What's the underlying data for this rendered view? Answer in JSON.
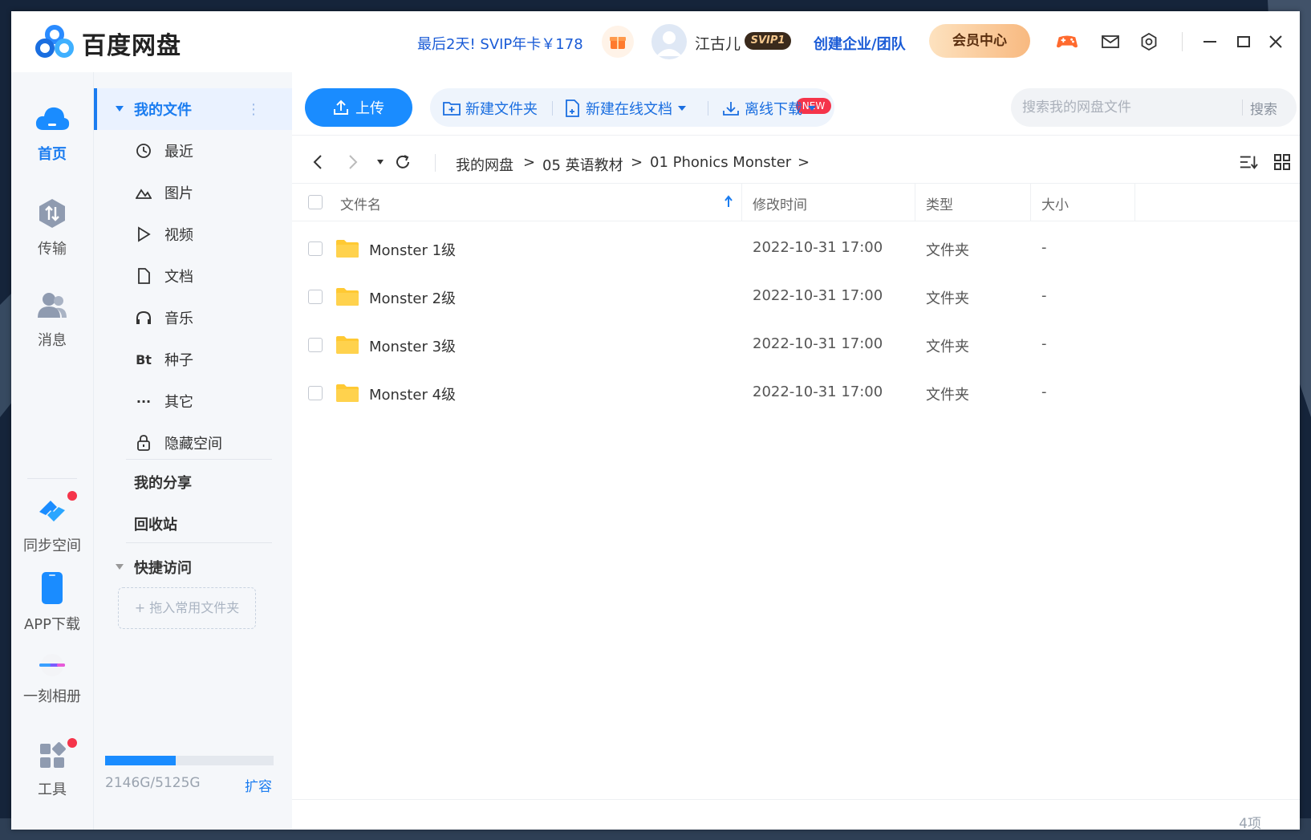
{
  "app": {
    "title": "百度网盘",
    "promo": "最后2天! SVIP年卡￥178",
    "username": "江古儿",
    "svip_badge": "SVIP1",
    "enterprise": "创建企业/团队",
    "member_center": "会员中心"
  },
  "leftnav": [
    {
      "label": "首页",
      "icon": "cloud-icon",
      "active": true
    },
    {
      "label": "传输",
      "icon": "transfer-icon",
      "active": false
    },
    {
      "label": "消息",
      "icon": "message-icon",
      "active": false
    },
    {
      "label": "同步空间",
      "icon": "sync-icon",
      "active": false
    },
    {
      "label": "APP下载",
      "icon": "phone-icon",
      "active": false
    },
    {
      "label": "一刻相册",
      "icon": "album-icon",
      "active": false
    },
    {
      "label": "工具",
      "icon": "tools-icon",
      "active": false
    }
  ],
  "sidebar": {
    "my_files": "我的文件",
    "items": [
      {
        "label": "最近",
        "icon": "clock-icon"
      },
      {
        "label": "图片",
        "icon": "image-icon"
      },
      {
        "label": "视频",
        "icon": "video-icon"
      },
      {
        "label": "文档",
        "icon": "document-icon"
      },
      {
        "label": "音乐",
        "icon": "headphones-icon"
      },
      {
        "label": "种子",
        "icon": "bt-icon"
      },
      {
        "label": "其它",
        "icon": "more-icon"
      },
      {
        "label": "隐藏空间",
        "icon": "lock-icon"
      }
    ],
    "bt_glyph": "Bt",
    "my_share": "我的分享",
    "recycle": "回收站",
    "quick_access": "快捷访问",
    "drop_hint": "+ 拖入常用文件夹",
    "storage_text": "2146G/5125G",
    "storage_used_fraction": 0.419,
    "expand": "扩容"
  },
  "toolbar": {
    "upload": "上传",
    "new_folder": "新建文件夹",
    "new_doc": "新建在线文档",
    "new_badge": "NEW",
    "offline_download": "离线下载",
    "search_placeholder": "搜索我的网盘文件",
    "search_button": "搜索"
  },
  "breadcrumb": [
    "我的网盘",
    "05 英语教材",
    "01 Phonics Monster"
  ],
  "breadcrumb_sep": ">",
  "table": {
    "headers": {
      "name": "文件名",
      "modified": "修改时间",
      "type": "类型",
      "size": "大小"
    },
    "rows": [
      {
        "name": "Monster 1级",
        "modified": "2022-10-31 17:00",
        "type": "文件夹",
        "size": "-"
      },
      {
        "name": "Monster 2级",
        "modified": "2022-10-31 17:00",
        "type": "文件夹",
        "size": "-"
      },
      {
        "name": "Monster 3级",
        "modified": "2022-10-31 17:00",
        "type": "文件夹",
        "size": "-"
      },
      {
        "name": "Monster 4级",
        "modified": "2022-10-31 17:00",
        "type": "文件夹",
        "size": "-"
      }
    ]
  },
  "item_count": "4项",
  "colors": {
    "accent": "#1a8cff",
    "link": "#1a5bd6",
    "folder": "#ffc933"
  }
}
